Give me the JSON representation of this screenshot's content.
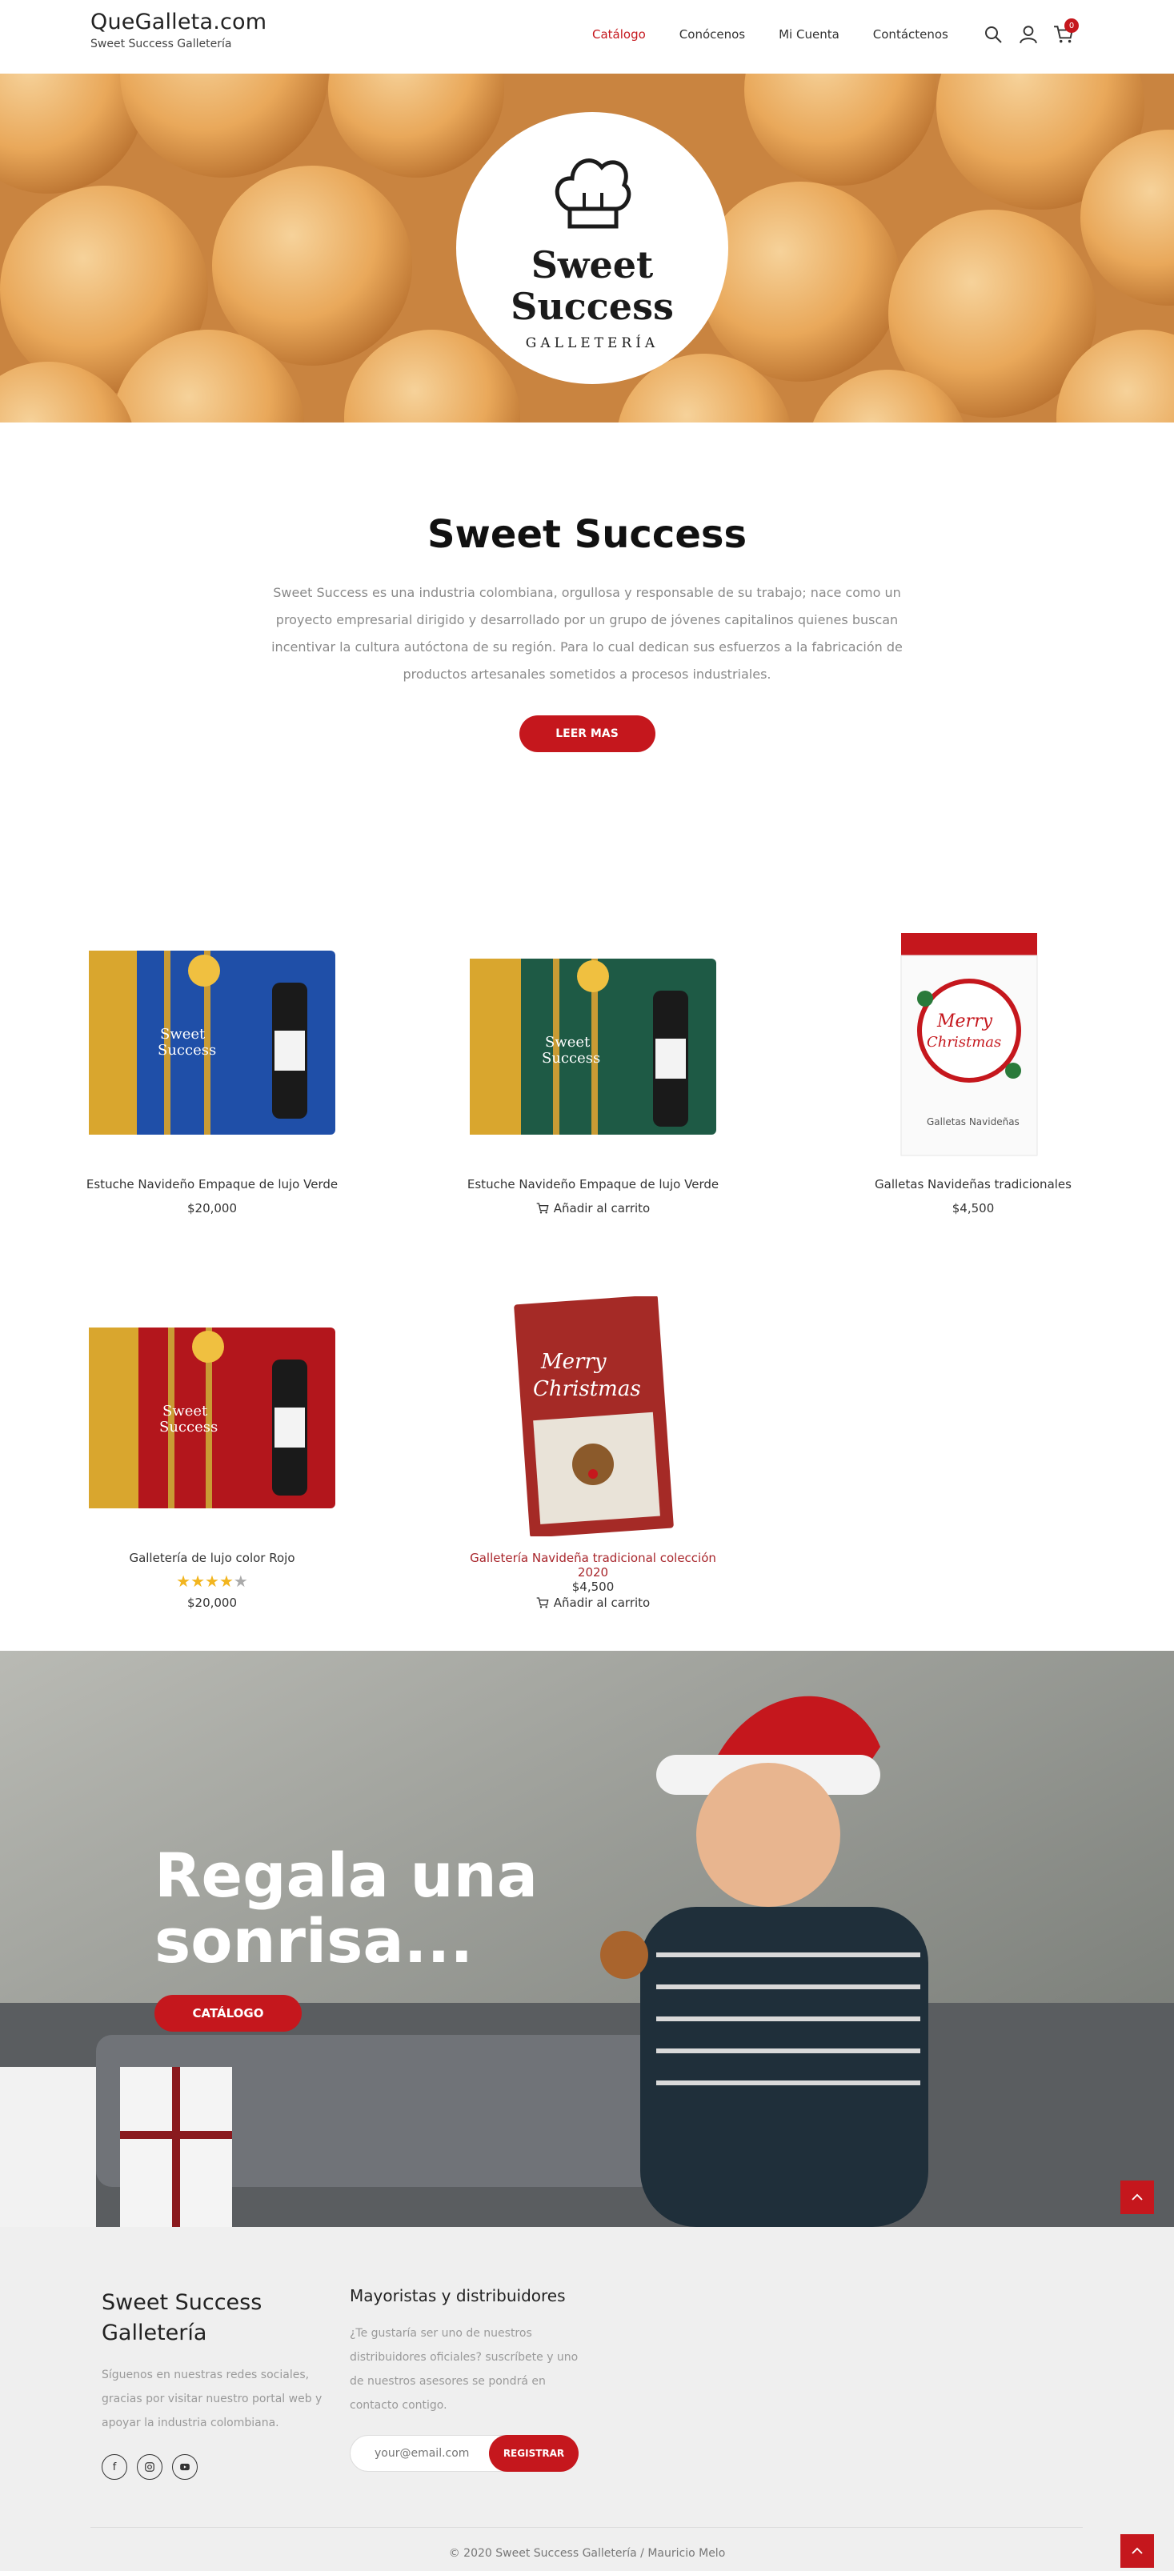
{
  "header": {
    "brand_title": "QueGalleta.com",
    "brand_subtitle": "Sweet Success Galletería",
    "nav": [
      {
        "label": "Catálogo",
        "active": true
      },
      {
        "label": "Conócenos",
        "active": false
      },
      {
        "label": "Mi Cuenta",
        "active": false
      },
      {
        "label": "Contáctenos",
        "active": false
      }
    ],
    "cart_count": "0",
    "icons": [
      "search-icon",
      "user-icon",
      "cart-icon"
    ]
  },
  "hero": {
    "logo_line1": "Sweet",
    "logo_line2": "Success",
    "logo_line3": "GALLETERÍA"
  },
  "about": {
    "title": "Sweet Success",
    "text": "Sweet Success es una industria colombiana, orgullosa y responsable de su trabajo; nace como un proyecto empresarial dirigido y desarrollado por un grupo de jóvenes capitalinos quienes buscan incentivar la cultura autóctona de su región. Para lo cual dedican sus esfuerzos a la fabricación de productos artesanales sometidos a procesos industriales.",
    "button": "LEER MAS"
  },
  "products": [
    {
      "name": "Estuche Navideño Empaque de lujo Verde",
      "price": "$20,000",
      "color": "#1f4fa8"
    },
    {
      "name": "Estuche Navideño Empaque de lujo Verde",
      "add_to_cart": "Añadir al carrito",
      "color": "#1e5a45"
    },
    {
      "name": "Galletas Navideñas tradicionales",
      "price": "$4,500"
    },
    {
      "name": "Galletería de lujo color Rojo",
      "price": "$20,000",
      "rating": 4,
      "color": "#b3161c"
    },
    {
      "name": "Galletería Navideña tradicional colección 2020",
      "price": "$4,500",
      "add_to_cart": "Añadir al carrito"
    }
  ],
  "banner": {
    "title_line1": "Regala una",
    "title_line2": "sonrisa...",
    "button": "CATÁLOGO"
  },
  "footer": {
    "col1_title": "Sweet Success Galletería",
    "col1_text": "Síguenos en nuestras redes sociales, gracias por visitar nuestro portal web y apoyar la industria colombiana.",
    "socials": [
      "facebook-icon",
      "instagram-icon",
      "youtube-icon"
    ],
    "col2_title": "Mayoristas y distribuidores",
    "col2_text": "¿Te gustaría ser uno de nuestros distribuidores oficiales?  suscríbete y uno de nuestros asesores se pondrá en contacto contigo.",
    "email_placeholder": "your@email.com",
    "subscribe_button": "REGISTRAR",
    "copyright": "© 2020 Sweet Success Galletería / Mauricio Melo"
  },
  "colors": {
    "accent": "#c5171d",
    "text": "#333333",
    "muted": "#8a8a8a",
    "footer_bg": "#efefef"
  }
}
